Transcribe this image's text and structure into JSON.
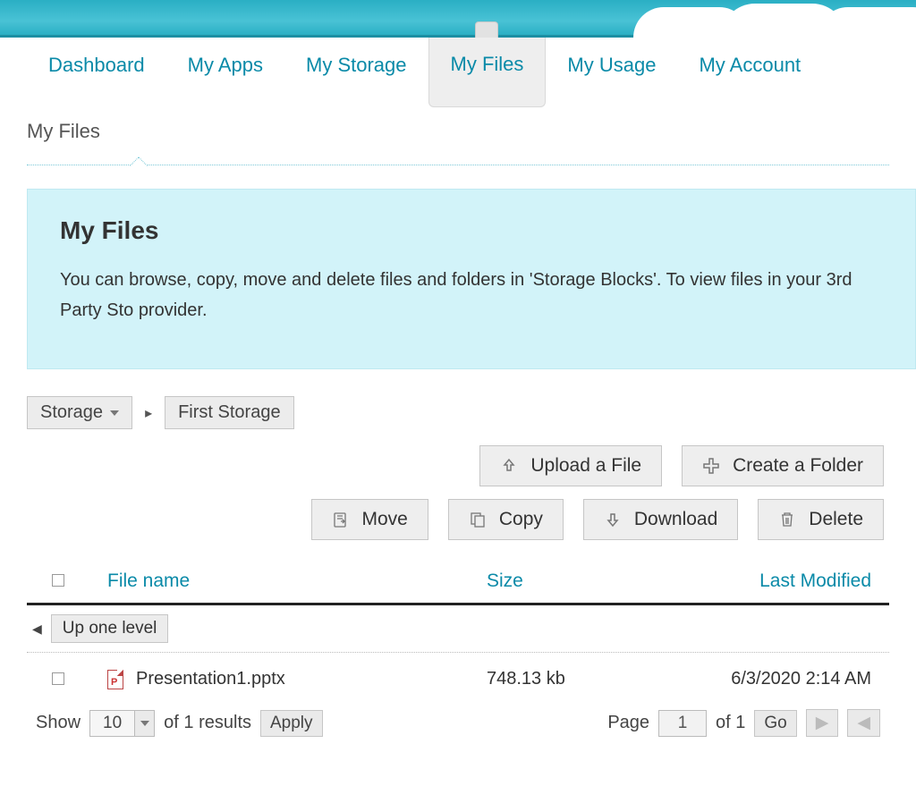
{
  "nav": {
    "items": [
      {
        "label": "Dashboard",
        "active": false
      },
      {
        "label": "My Apps",
        "active": false
      },
      {
        "label": "My Storage",
        "active": false
      },
      {
        "label": "My Files",
        "active": true
      },
      {
        "label": "My Usage",
        "active": false
      },
      {
        "label": "My Account",
        "active": false
      }
    ]
  },
  "page": {
    "title": "My Files"
  },
  "panel": {
    "heading": "My Files",
    "body": "You can browse, copy, move and delete files and folders in 'Storage Blocks'. To view files in your 3rd Party Sto provider."
  },
  "breadcrumb": {
    "root": "Storage",
    "current": "First Storage"
  },
  "actions": {
    "upload": "Upload a File",
    "create_folder": "Create a Folder",
    "move": "Move",
    "copy": "Copy",
    "download": "Download",
    "delete": "Delete"
  },
  "table": {
    "headers": {
      "name": "File name",
      "size": "Size",
      "modified": "Last Modified"
    },
    "up_one_level": "Up one level",
    "rows": [
      {
        "name": "Presentation1.pptx",
        "size": "748.13 kb",
        "modified": "6/3/2020 2:14 AM"
      }
    ]
  },
  "pager": {
    "show_label": "Show",
    "per_page": "10",
    "of_results": "of 1 results",
    "apply": "Apply",
    "page_label": "Page",
    "page_value": "1",
    "of_pages": "of 1",
    "go": "Go"
  }
}
